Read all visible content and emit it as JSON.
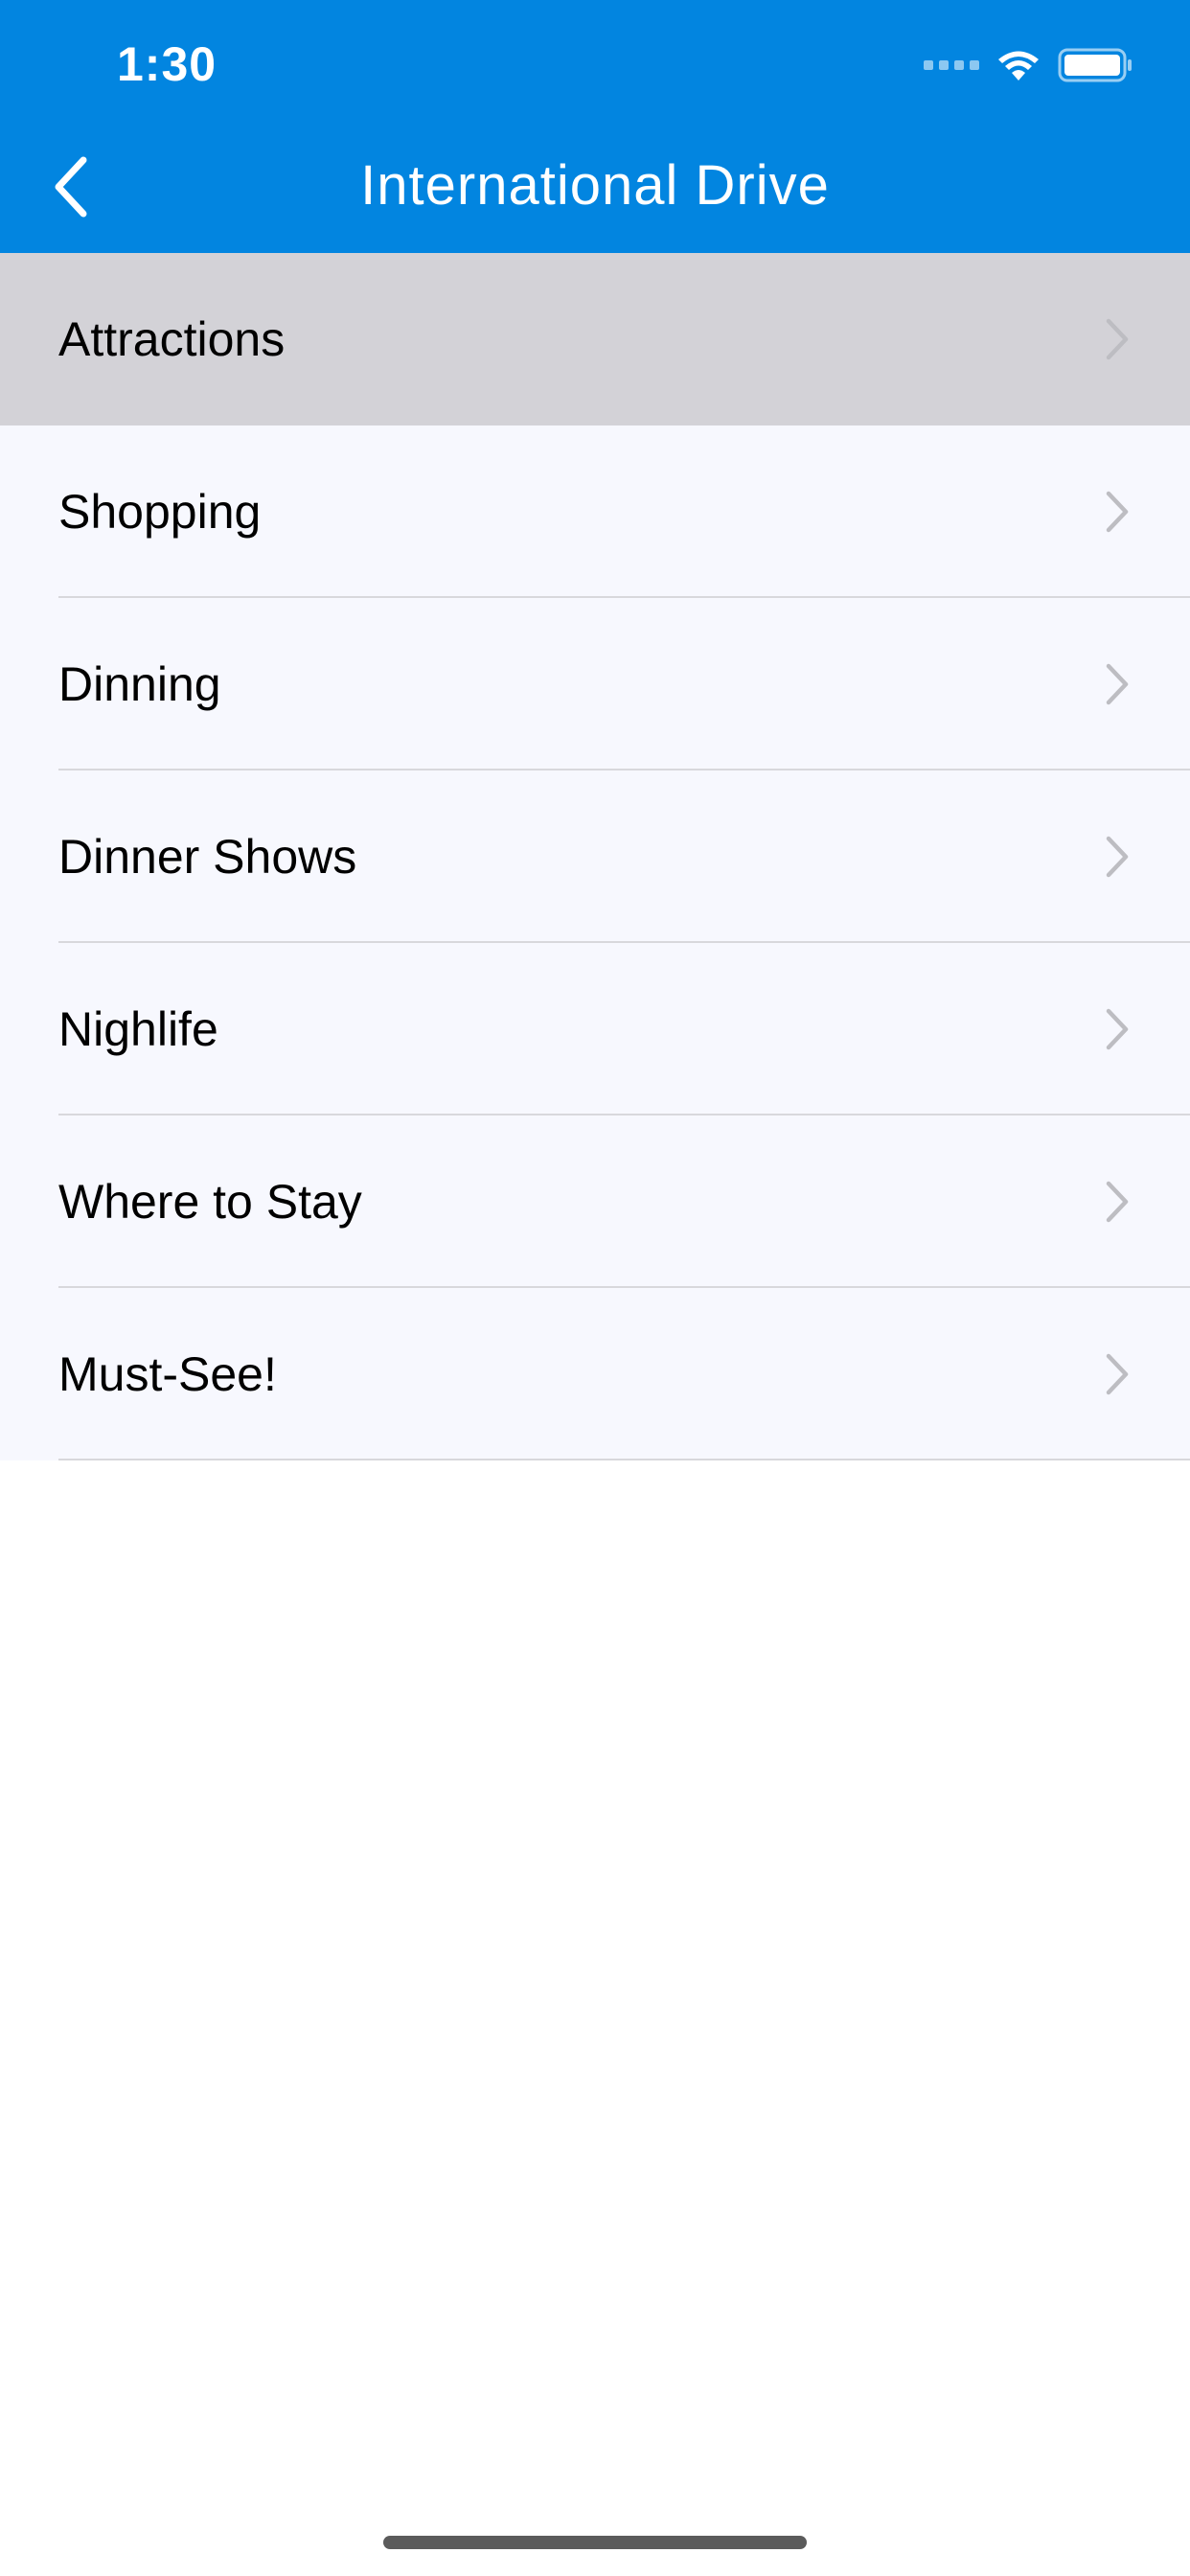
{
  "status_bar": {
    "time": "1:30",
    "icons": [
      "signal-dots-icon",
      "wifi-icon",
      "battery-icon"
    ]
  },
  "nav_bar": {
    "title": "International Drive",
    "back_icon": "chevron-left-icon"
  },
  "colors": {
    "header_bg": "#0285E0",
    "row_bg": "#F7F8FE",
    "row_selected_bg": "#D3D2D7",
    "separator": "#D8D8DC",
    "chevron": "#BDBDC2"
  },
  "menu": {
    "items": [
      {
        "label": "Attractions",
        "selected": true
      },
      {
        "label": "Shopping",
        "selected": false
      },
      {
        "label": "Dinning",
        "selected": false
      },
      {
        "label": "Dinner Shows",
        "selected": false
      },
      {
        "label": "Nighlife",
        "selected": false
      },
      {
        "label": "Where to Stay",
        "selected": false
      },
      {
        "label": "Must-See!",
        "selected": false
      }
    ]
  }
}
